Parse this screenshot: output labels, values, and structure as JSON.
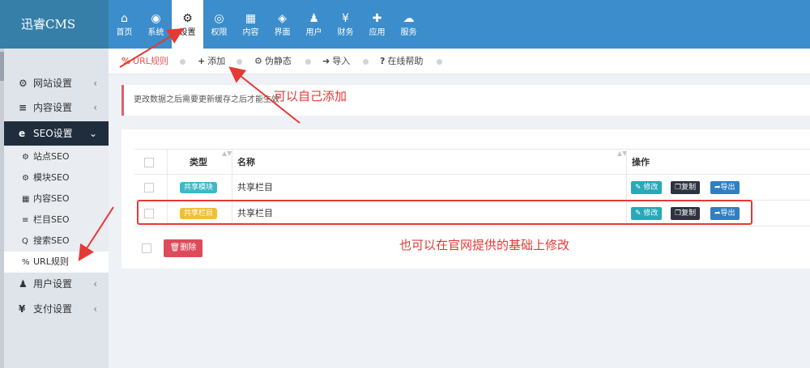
{
  "brand": "迅睿CMS",
  "topnav": [
    {
      "icon": "home-icon",
      "glyph": "⌂",
      "label": "首页"
    },
    {
      "icon": "globe-icon",
      "glyph": "◉",
      "label": "系统"
    },
    {
      "icon": "gears-icon",
      "glyph": "⚙",
      "label": "设置"
    },
    {
      "icon": "user-circle-icon",
      "glyph": "◎",
      "label": "权限"
    },
    {
      "icon": "grid-icon",
      "glyph": "▦",
      "label": "内容"
    },
    {
      "icon": "html5-icon",
      "glyph": "◈",
      "label": "界面"
    },
    {
      "icon": "user-icon",
      "glyph": "♟",
      "label": "用户"
    },
    {
      "icon": "yen-icon",
      "glyph": "¥",
      "label": "财务"
    },
    {
      "icon": "puzzle-icon",
      "glyph": "✚",
      "label": "应用"
    },
    {
      "icon": "cloud-icon",
      "glyph": "☁",
      "label": "服务"
    }
  ],
  "sidebar": {
    "menus": [
      {
        "icon": "gear-icon",
        "glyph": "⚙",
        "label": "网站设置",
        "chevron": "‹"
      },
      {
        "icon": "list-icon",
        "glyph": "≡",
        "label": "内容设置",
        "chevron": "‹"
      },
      {
        "icon": "ie-icon",
        "glyph": "e",
        "label": "SEO设置",
        "chevron": "⌄"
      }
    ],
    "sub": [
      {
        "icon": "gear-icon",
        "glyph": "⚙",
        "label": "站点SEO"
      },
      {
        "icon": "gears-icon",
        "glyph": "⚙",
        "label": "模块SEO"
      },
      {
        "icon": "grid-icon",
        "glyph": "▦",
        "label": "内容SEO"
      },
      {
        "icon": "list-icon",
        "glyph": "≡",
        "label": "栏目SEO"
      },
      {
        "icon": "search-icon",
        "glyph": "Q",
        "label": "搜索SEO"
      },
      {
        "icon": "link-icon",
        "glyph": "%",
        "label": "URL规则"
      }
    ],
    "menus2": [
      {
        "icon": "user-icon",
        "glyph": "♟",
        "label": "用户设置",
        "chevron": "‹"
      },
      {
        "icon": "yen-icon",
        "glyph": "¥",
        "label": "支付设置",
        "chevron": "‹"
      }
    ]
  },
  "tabs": [
    {
      "icon": "link-icon",
      "glyph": "%",
      "label": "URL规则"
    },
    {
      "icon": "plus-icon",
      "glyph": "+",
      "label": "添加"
    },
    {
      "icon": "gear-icon",
      "glyph": "⚙",
      "label": "伪静态"
    },
    {
      "icon": "sign-in-icon",
      "glyph": "➜",
      "label": "导入"
    },
    {
      "icon": "question-icon",
      "glyph": "?",
      "label": "在线帮助"
    }
  ],
  "notice": "更改数据之后需要更新缓存之后才能生效",
  "table": {
    "headers": {
      "type": "类型",
      "name": "名称",
      "ops": "操作"
    },
    "rows": [
      {
        "badge": "共享模块",
        "badge_color": "#3bb9c6",
        "name": "共享栏目"
      },
      {
        "badge": "共享栏目",
        "badge_color": "#f0c033",
        "name": "共享栏目"
      }
    ],
    "actions": {
      "edit": "修改",
      "copy": "复制",
      "export": "导出"
    },
    "delete": "删除"
  },
  "annotations": {
    "add_note": "可以自己添加",
    "modify_note": "也可以在官网提供的基础上修改"
  }
}
